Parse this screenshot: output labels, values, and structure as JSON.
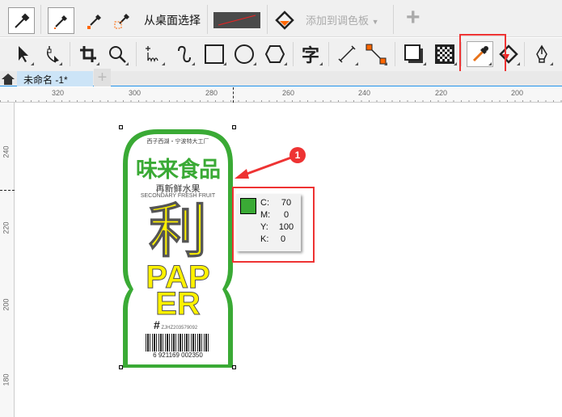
{
  "toolbar1": {
    "pick_from_desktop": "从桌面选择",
    "add_to_palette": "添加到调色板",
    "add_icon": "+"
  },
  "toolbar2": {
    "text_tool": "字"
  },
  "tabs": [
    {
      "label": "未命名 -1*"
    }
  ],
  "tab_add": "+",
  "ruler_top": [
    "320",
    "300",
    "280",
    "260",
    "240",
    "220",
    "200"
  ],
  "ruler_left": [
    "240",
    "220",
    "200",
    "180"
  ],
  "artwork": {
    "top_line": "西子西湖・宁波特大工厂",
    "brand": "味来食品",
    "subtitle": "再新鲜水果",
    "subtitle_en": "SECONDARY FRESH FRUIT",
    "big_cn": "利",
    "big_en_line1": "PAP",
    "big_en_line2": "ER",
    "code": "ZJHZ203579092",
    "barcode": "6 921169 002350"
  },
  "annotation": {
    "number": "1"
  },
  "color_tooltip": {
    "swatch": "#3aaa35",
    "rows": [
      {
        "k": "C:",
        "v": "70"
      },
      {
        "k": "M:",
        "v": "0"
      },
      {
        "k": "Y:",
        "v": "100"
      },
      {
        "k": "K:",
        "v": "0"
      }
    ]
  },
  "colors": {
    "highlight": "#ee3333",
    "selected_tab": "#cce4f7",
    "accent": "#1e90e8"
  }
}
